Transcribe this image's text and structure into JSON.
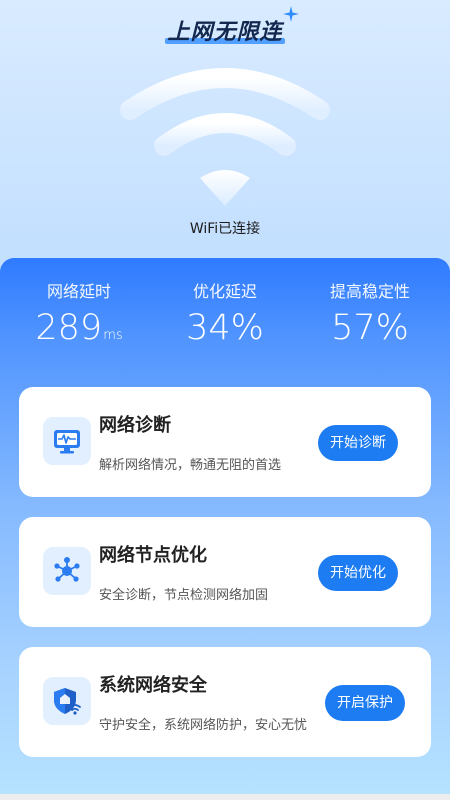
{
  "header": {
    "app_title": "上网无限连"
  },
  "hero": {
    "wifi_status": "WiFi已连接"
  },
  "stats": [
    {
      "label": "网络延时",
      "value": "289",
      "unit": "ms"
    },
    {
      "label": "优化延迟",
      "value": "34%",
      "unit": ""
    },
    {
      "label": "提高稳定性",
      "value": "57%",
      "unit": ""
    }
  ],
  "cards": [
    {
      "title": "网络诊断",
      "description": "解析网络情况，畅通无阻的首选",
      "button": "开始诊断",
      "icon": "monitor-pulse-icon"
    },
    {
      "title": "网络节点优化",
      "description": "安全诊断，节点检测网络加固",
      "button": "开始优化",
      "icon": "network-nodes-icon"
    },
    {
      "title": "系统网络安全",
      "description": "守护安全，系统网络防护，安心无忧",
      "button": "开启保护",
      "icon": "shield-wifi-icon"
    }
  ],
  "colors": {
    "accent": "#1e7cf2",
    "panel_top": "#2f7bff",
    "icon_bg": "#e2efff",
    "title_dark": "#12284f"
  }
}
